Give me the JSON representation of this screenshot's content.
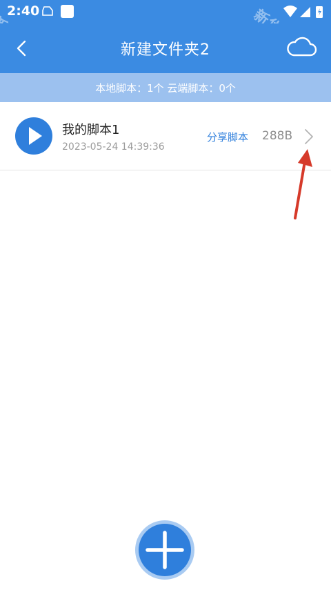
{
  "status_bar": {
    "time": "2:40"
  },
  "header": {
    "title": "新建文件夹2"
  },
  "info_bar": {
    "text": "本地脚本：1个 云端脚本：0个"
  },
  "scripts": [
    {
      "name": "我的脚本1",
      "date": "2023-05-24 14:39:36",
      "share_label": "分享脚本",
      "size": "288B"
    }
  ],
  "watermark": {
    "text": "新华手游网"
  },
  "colors": {
    "primary": "#3b8be2",
    "info_bar": "#9cc1ef",
    "accent": "#2f7fdc",
    "annotation": "#d63a2a"
  },
  "icons": {
    "back": "chevron-left-icon",
    "cloud": "cloud-icon",
    "play": "play-icon",
    "chevron": "chevron-right-icon",
    "add": "plus-icon"
  }
}
